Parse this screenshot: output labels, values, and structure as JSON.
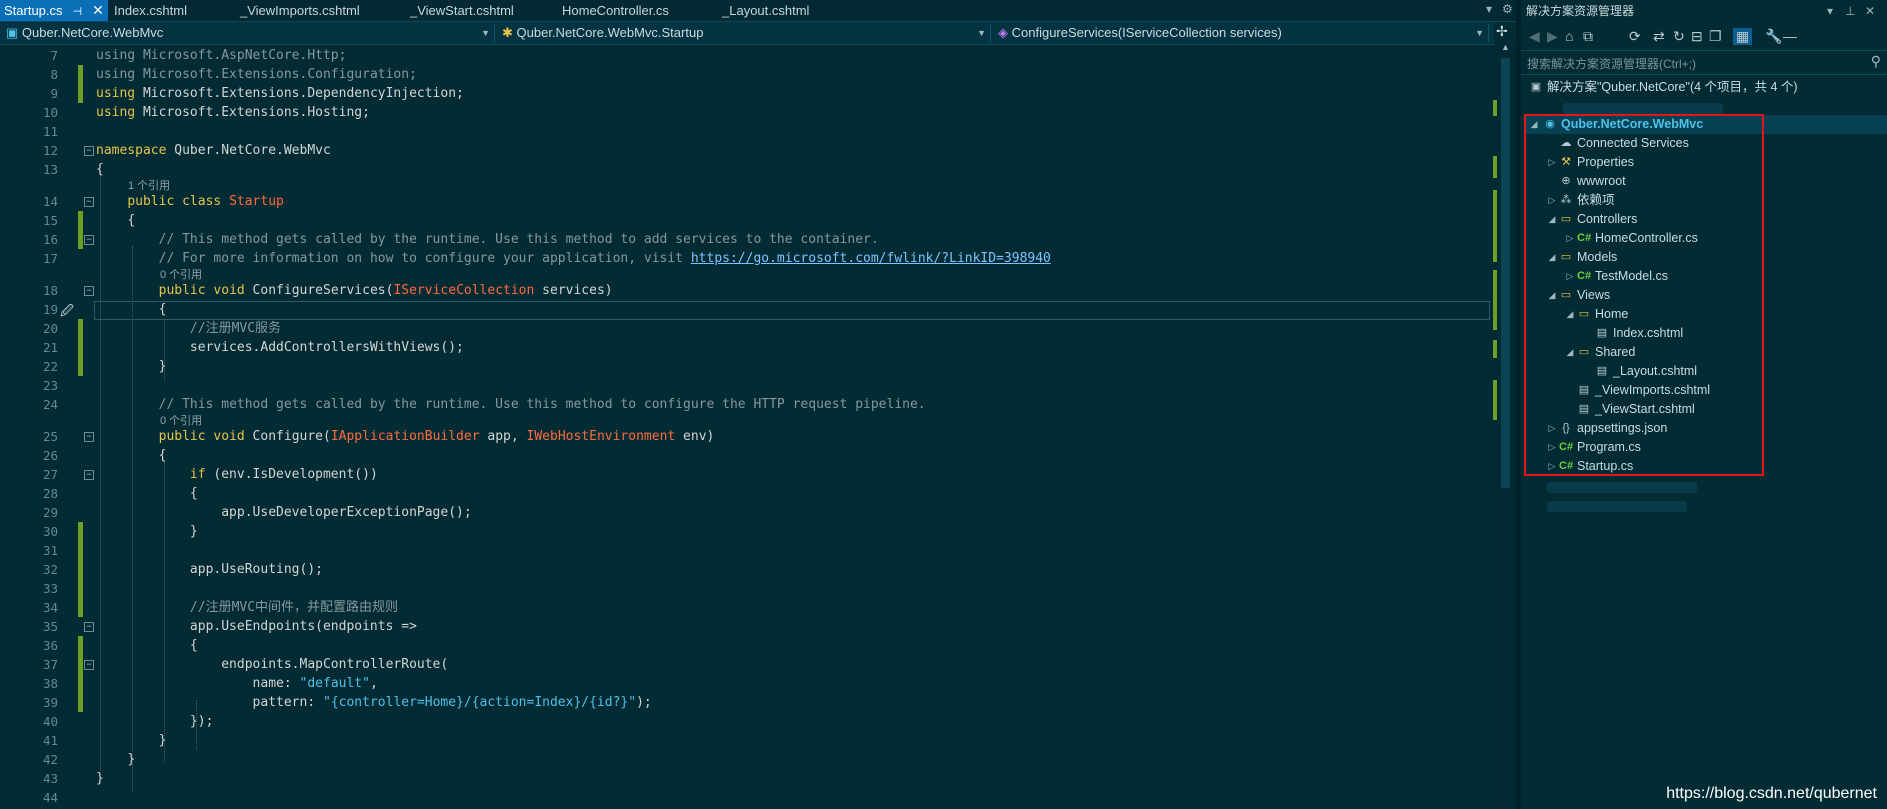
{
  "tabs": [
    {
      "label": "Startup.cs",
      "active": true,
      "pin": "⊣",
      "close": "✕"
    },
    {
      "label": "Index.cshtml"
    },
    {
      "label": "_ViewImports.cshtml"
    },
    {
      "label": "_ViewStart.cshtml"
    },
    {
      "label": "HomeController.cs"
    },
    {
      "label": "_Layout.cshtml"
    }
  ],
  "nav": {
    "project": "Quber.NetCore.WebMvc",
    "type": "Quber.NetCore.WebMvc.Startup",
    "member": "ConfigureServices(IServiceCollection services)"
  },
  "code": {
    "ln": [
      "7",
      "8",
      "9",
      "10",
      "11",
      "12",
      "13",
      "14",
      "15",
      "16",
      "17",
      "18",
      "19",
      "20",
      "21",
      "22",
      "23",
      "24",
      "25",
      "26",
      "27",
      "28",
      "29",
      "30",
      "31",
      "32",
      "33",
      "34",
      "35",
      "36",
      "37",
      "38",
      "39",
      "40",
      "41",
      "42",
      "43",
      "44"
    ],
    "refs": {
      "r1": "1 个引用",
      "r2": "0 个引用",
      "r3": "0 个引用"
    },
    "t": {
      "using": "using",
      "ns_http": "Microsoft.AspNetCore.Http;",
      "ns_config": "Microsoft.Extensions.Configuration;",
      "ns_di": "Microsoft.Extensions.DependencyInjection;",
      "ns_hosting": "Microsoft.Extensions.Hosting;",
      "namespace_kw": "namespace",
      "namespace_name": " Quber.NetCore.WebMvc",
      "lbrace": "{",
      "rbrace": "}",
      "public": "public",
      "class": "class",
      "void": "void",
      "startup": "Startup",
      "cmt1": "// This method gets called by the runtime. Use this method to add services to the container.",
      "cmt2a": "// For more information on how to configure your application, visit ",
      "cmt2link": "https://go.microsoft.com/fwlink/?LinkID=398940",
      "cs_name": " ConfigureServices(",
      "iservice": "IServiceCollection",
      "services_param": " services)",
      "cmt_mvc": "//注册MVC服务",
      "add_controllers": "services.AddControllersWithViews();",
      "cmt3": "// This method gets called by the runtime. Use this method to configure the HTTP request pipeline.",
      "configure_name": " Configure(",
      "iapp": "IApplicationBuilder",
      "app_param": " app, ",
      "ienv": "IWebHostEnvironment",
      "env_param": " env)",
      "if_kw": "if",
      "if_rest": " (env.IsDevelopment())",
      "use_dev": "app.UseDeveloperExceptionPage();",
      "use_routing": "app.UseRouting();",
      "cmt_mid": "//注册MVC中间件，并配置路由规则",
      "use_endpoints": "app.UseEndpoints(endpoints =>",
      "map_route": "endpoints.MapControllerRoute(",
      "name_key": "name: ",
      "name_val": "\"default\"",
      "name_comma": ",",
      "pattern_key": "pattern: ",
      "pattern_val": "\"{controller=Home}/{action=Index}/{id?}\"",
      "pattern_end": ");",
      "close_paren": "});"
    }
  },
  "solution_explorer": {
    "title": "解决方案资源管理器",
    "search_placeholder": "搜索解决方案资源管理器(Ctrl+;)",
    "solution_label": "解决方案\"Quber.NetCore\"(4 个项目，共 4 个)",
    "items": [
      {
        "label": "Quber.NetCore.WebMvc",
        "icon": "project-icon"
      },
      {
        "label": "Connected Services",
        "icon": "connected-icon"
      },
      {
        "label": "Properties",
        "icon": "properties-icon"
      },
      {
        "label": "wwwroot",
        "icon": "globe-icon"
      },
      {
        "label": "依赖项",
        "icon": "dependencies-icon"
      },
      {
        "label": "Controllers",
        "icon": "folder-icon"
      },
      {
        "label": "HomeController.cs",
        "icon": "csharp-icon"
      },
      {
        "label": "Models",
        "icon": "folder-icon"
      },
      {
        "label": "TestModel.cs",
        "icon": "csharp-icon"
      },
      {
        "label": "Views",
        "icon": "folder-icon"
      },
      {
        "label": "Home",
        "icon": "folder-icon"
      },
      {
        "label": "Index.cshtml",
        "icon": "file-icon"
      },
      {
        "label": "Shared",
        "icon": "folder-icon"
      },
      {
        "label": "_Layout.cshtml",
        "icon": "file-icon"
      },
      {
        "label": "_ViewImports.cshtml",
        "icon": "file-icon"
      },
      {
        "label": "_ViewStart.cshtml",
        "icon": "file-icon"
      },
      {
        "label": "appsettings.json",
        "icon": "json-icon"
      },
      {
        "label": "Program.cs",
        "icon": "csharp-icon"
      },
      {
        "label": "Startup.cs",
        "icon": "csharp-icon"
      }
    ]
  },
  "watermark": "https://blog.csdn.net/qubernet",
  "colors": {
    "background": "#022b34",
    "active_tab": "#0b6fb8",
    "keyword": "#e8c54a",
    "type": "#ff6b3d",
    "change_marker": "#6aa024",
    "highlight_box": "#e0161b"
  }
}
